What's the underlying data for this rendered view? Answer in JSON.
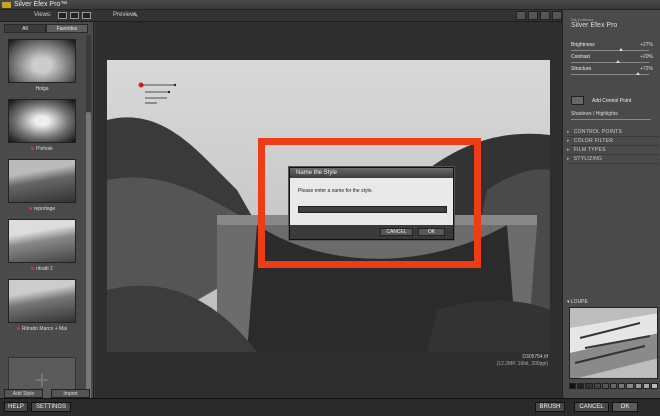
{
  "app": {
    "title": "Silver Efex Pro™"
  },
  "toolbar": {
    "views_label": "Views:",
    "preview_label": "Preview:"
  },
  "left_panel": {
    "tabs": [
      "All",
      "Favorites"
    ],
    "presets": [
      {
        "name": "Holga",
        "favorite": false
      },
      {
        "name": "Pinhole",
        "favorite": true
      },
      {
        "name": "reportage",
        "favorite": true
      },
      {
        "name": "ritratti 2",
        "favorite": true
      },
      {
        "name": "Ritratto Marco + Mai",
        "favorite": true
      }
    ],
    "add_style_label": "Add Style",
    "import_label": "Import"
  },
  "canvas": {
    "file_name": "D305754.tif",
    "file_meta": "(12.2MP, 16bit, 300ppi)"
  },
  "dialog": {
    "title": "Name the Style",
    "prompt": "Please enter a name for the style.",
    "input_value": "",
    "cancel_label": "CANCEL",
    "ok_label": "OK"
  },
  "right_panel": {
    "company": "Nik Software",
    "product": "Silver Efex Pro",
    "sliders": [
      {
        "name": "Brightness",
        "value": "+27%",
        "level": 0.64
      },
      {
        "name": "Contrast",
        "value": "+20%",
        "level": 0.6
      },
      {
        "name": "Structure",
        "value": "+72%",
        "level": 0.86
      }
    ],
    "control_point_label": "Add Control Point",
    "shadows_label": "Shadows / Highlights",
    "sections": [
      "CONTROL POINTS",
      "COLOR FILTER",
      "FILM TYPES",
      "STYLIZING"
    ],
    "loupe_label": "LOUPE"
  },
  "bottom": {
    "help": "HELP",
    "settings": "SETTINGS",
    "brush": "BRUSH",
    "cancel": "CANCEL",
    "ok": "OK"
  },
  "colors": {
    "accent_red": "#ee3c16",
    "panel": "#4a4a4a",
    "dark": "#2a2a2a"
  }
}
